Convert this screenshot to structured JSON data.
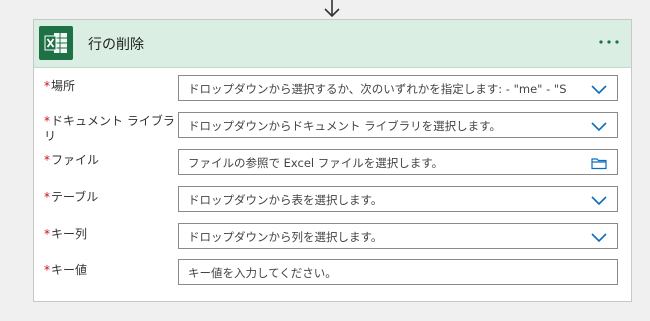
{
  "action": {
    "title": "行の削除",
    "accent_color": "#1e7145",
    "header_bg": "#dbeee3",
    "logo_icon": "excel-icon",
    "more_icon": "ellipsis-icon"
  },
  "fields": [
    {
      "label": "場所",
      "required": "*",
      "placeholder": "ドロップダウンから選択するか、次のいずれかを指定します: - \"me\" - \"S",
      "icon": "chevron-down-icon"
    },
    {
      "label": "ドキュメント ライブラリ",
      "required": "*",
      "placeholder": "ドロップダウンからドキュメント ライブラリを選択します。",
      "icon": "chevron-down-icon"
    },
    {
      "label": "ファイル",
      "required": "*",
      "placeholder": "ファイルの参照で Excel ファイルを選択します。",
      "icon": "folder-icon"
    },
    {
      "label": "テーブル",
      "required": "*",
      "placeholder": "ドロップダウンから表を選択します。",
      "icon": "chevron-down-icon"
    },
    {
      "label": "キー列",
      "required": "*",
      "placeholder": "ドロップダウンから列を選択します。",
      "icon": "chevron-down-icon"
    },
    {
      "label": "キー値",
      "required": "*",
      "placeholder": "キー値を入力してください。",
      "icon": ""
    }
  ]
}
